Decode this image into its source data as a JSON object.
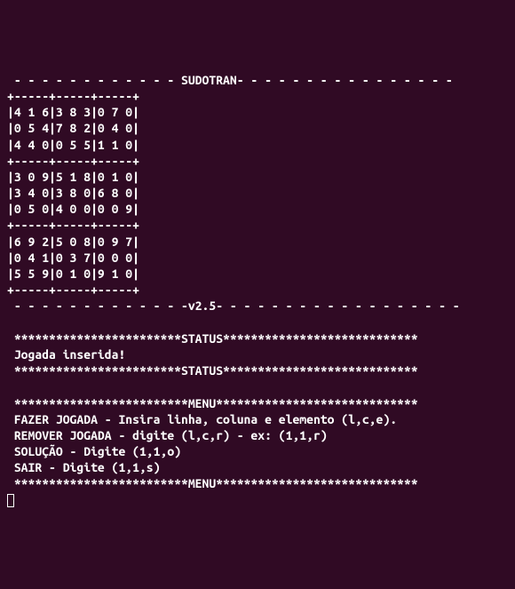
{
  "header": {
    "title_line": " - - - - - - - - - - - - SUDOTRAN- - - - - - - - - - - - - - - -"
  },
  "grid": {
    "sep1": "+-----+-----+-----+",
    "row1": "|4 1 6|3 8 3|0 7 0|",
    "row2": "|0 5 4|7 8 2|0 4 0|",
    "row3": "|4 4 0|0 5 5|1 1 0|",
    "sep2": "+-----+-----+-----+",
    "row4": "|3 0 9|5 1 8|0 1 0|",
    "row5": "|3 4 0|3 8 0|6 8 0|",
    "row6": "|0 5 0|4 0 0|0 0 9|",
    "sep3": "+-----+-----+-----+",
    "row7": "|6 9 2|5 0 8|0 9 7|",
    "row8": "|0 4 1|0 3 7|0 0 0|",
    "row9": "|5 5 9|0 1 0|9 1 0|",
    "sep4": "+-----+-----+-----+"
  },
  "version": {
    "line": " - - - - - - - - - - - - -v2.5- - - - - - - - - - - - - - - - - -"
  },
  "status": {
    "sep_top": " ************************STATUS****************************",
    "message": " Jogada inserida!",
    "sep_bottom": " ************************STATUS****************************"
  },
  "menu": {
    "sep_top": " *************************MENU*****************************",
    "line1": " FAZER JOGADA - Insira linha, coluna e elemento (l,c,e).",
    "line2": " REMOVER JOGADA - digite (l,c,r) - ex: (1,1,r)",
    "line3": " SOLUÇÃO - Digite (1,1,o)",
    "line4": " SAIR - Digite (1,1,s)",
    "sep_bottom": " *************************MENU*****************************"
  }
}
